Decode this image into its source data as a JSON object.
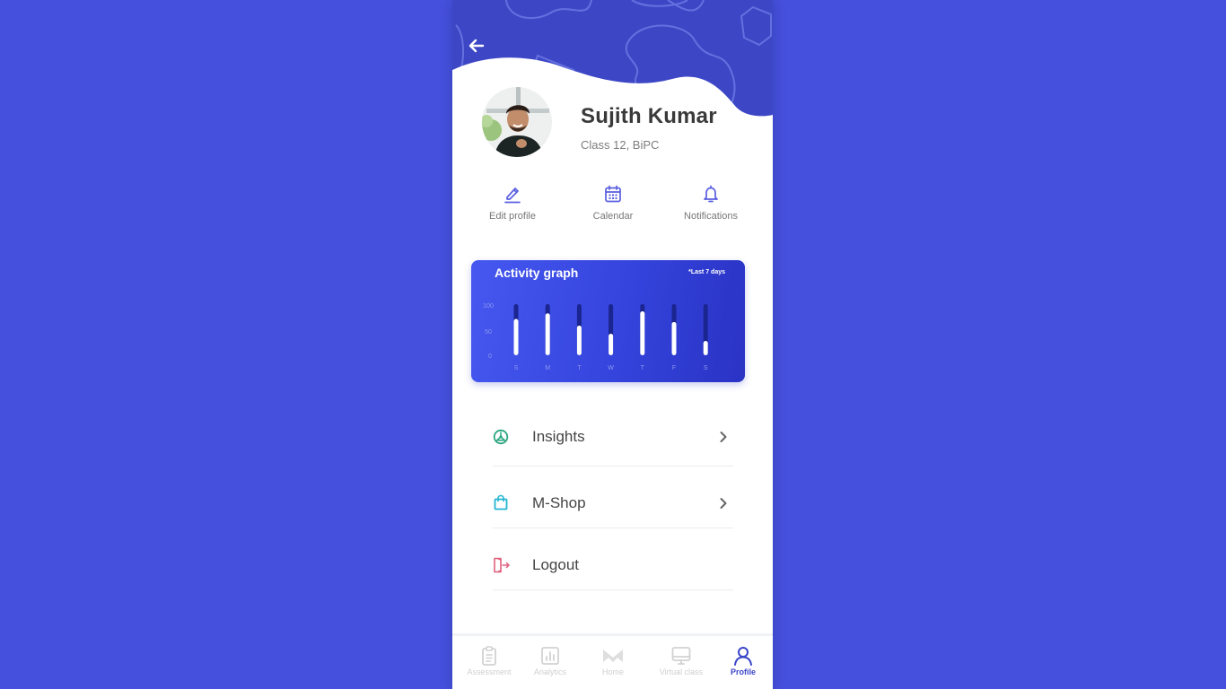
{
  "colors": {
    "page_background": "#4550dd",
    "header_background": "#3d47c6",
    "accent": "#5a5fe0",
    "active_tab": "#3a45c8",
    "insights_icon": "#2aa57f",
    "mshop_icon": "#23b5d3",
    "logout_icon": "#e0607e"
  },
  "header": {
    "back_icon": "arrow-left-icon"
  },
  "profile": {
    "name": "Sujith Kumar",
    "subtitle": "Class 12, BiPC",
    "avatar": "profile-photo"
  },
  "quick_actions": [
    {
      "label": "Edit profile",
      "icon": "pencil-icon"
    },
    {
      "label": "Calendar",
      "icon": "calendar-icon"
    },
    {
      "label": "Notifications",
      "icon": "bell-icon"
    }
  ],
  "activity": {
    "title": "Activity graph",
    "note": "*Last 7 days"
  },
  "chart_data": {
    "type": "bar",
    "title": "Activity graph",
    "subtitle": "*Last 7 days",
    "categories": [
      "S",
      "M",
      "T",
      "W",
      "T",
      "F",
      "S"
    ],
    "values": [
      71,
      82,
      58,
      42,
      86,
      65,
      28
    ],
    "yticks": [
      "100",
      "50",
      "0"
    ],
    "ylim": [
      0,
      100
    ],
    "xlabel": "",
    "ylabel": "",
    "grid": false
  },
  "menu": [
    {
      "label": "Insights",
      "icon": "insights-icon",
      "has_chevron": true
    },
    {
      "label": "M-Shop",
      "icon": "shopping-bag-icon",
      "has_chevron": true
    },
    {
      "label": "Logout",
      "icon": "logout-icon",
      "has_chevron": false
    }
  ],
  "tabs": [
    {
      "label": "Assessment",
      "icon": "clipboard-icon",
      "active": false
    },
    {
      "label": "Analytics",
      "icon": "bar-chart-icon",
      "active": false
    },
    {
      "label": "Home",
      "icon": "home-logo-icon",
      "active": false
    },
    {
      "label": "Virtual class",
      "icon": "monitor-icon",
      "active": false
    },
    {
      "label": "Profile",
      "icon": "user-icon",
      "active": true
    }
  ]
}
